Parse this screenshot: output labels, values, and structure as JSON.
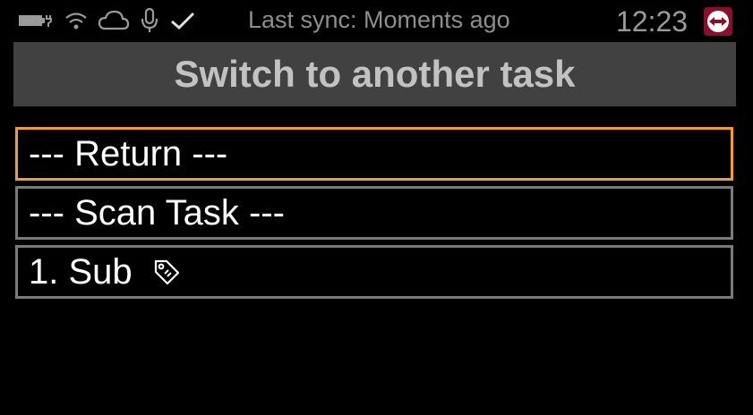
{
  "status_bar": {
    "icons": [
      "battery-charging-icon",
      "wifi-icon",
      "cloud-icon",
      "microphone-icon",
      "check-icon"
    ],
    "sync_text": "Last sync: Moments ago",
    "time": "12:23",
    "app_logo": "teamviewer-logo-icon"
  },
  "header": {
    "title": "Switch to another task"
  },
  "task_list": {
    "items": [
      {
        "label": "--- Return ---",
        "selected": true
      },
      {
        "label": "--- Scan Task ---",
        "selected": false
      },
      {
        "label": "1. Sub",
        "selected": false,
        "icon": "tag-icon"
      }
    ]
  },
  "colors": {
    "background": "#000000",
    "header_bg": "#414141",
    "header_text": "#c2c2c2",
    "selected_border": "#f39c2d",
    "item_border": "#7a7a7a",
    "logo_bg": "#8b0f2a"
  }
}
